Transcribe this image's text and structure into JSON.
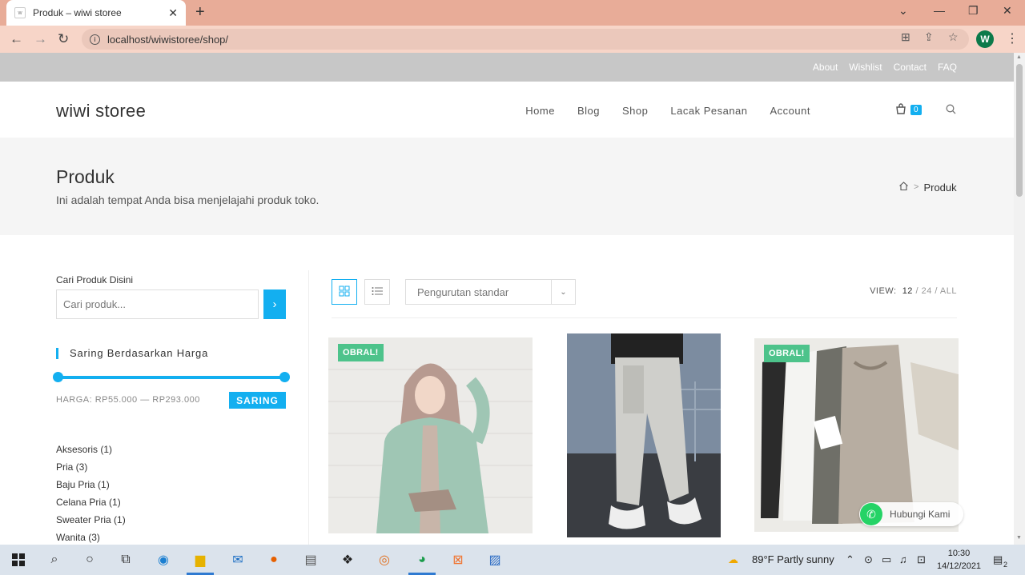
{
  "browser": {
    "tab_title": "Produk – wiwi storee",
    "favicon_text": "w",
    "url": "localhost/wiwistoree/shop/",
    "profile_initial": "W"
  },
  "topbar": {
    "links": [
      "About",
      "Wishlist",
      "Contact",
      "FAQ"
    ]
  },
  "header": {
    "logo": "wiwi storee",
    "nav": [
      "Home",
      "Blog",
      "Shop",
      "Lacak Pesanan",
      "Account"
    ],
    "cart_count": "0"
  },
  "hero": {
    "title": "Produk",
    "subtitle": "Ini adalah tempat Anda bisa menjelajahi produk toko.",
    "breadcrumb_current": "Produk"
  },
  "sidebar": {
    "search_label": "Cari Produk Disini",
    "search_placeholder": "Cari produk...",
    "price_heading": "Saring Berdasarkan Harga",
    "price_range": "HARGA: RP55.000 — RP293.000",
    "filter_button": "SARING",
    "categories": [
      "Aksesoris (1)",
      "Pria (3)",
      "Baju Pria (1)",
      "Celana Pria (1)",
      "Sweater Pria (1)",
      "Wanita (3)"
    ]
  },
  "toolbar": {
    "sort_selected": "Pengurutan standar",
    "view_label": "VIEW:",
    "view_options": [
      "12",
      "24",
      "ALL"
    ]
  },
  "products": [
    {
      "badge": "OBRAL!"
    },
    {
      "badge": ""
    },
    {
      "badge": "OBRAL!"
    }
  ],
  "whatsapp": {
    "label": "Hubungi Kami"
  },
  "taskbar": {
    "weather": "89°F  Partly sunny",
    "time": "10:30",
    "date": "14/12/2021",
    "notif_count": "2"
  },
  "colors": {
    "accent": "#13aff0",
    "sale": "#4dc38b",
    "tabbar": "#e8ac98"
  }
}
